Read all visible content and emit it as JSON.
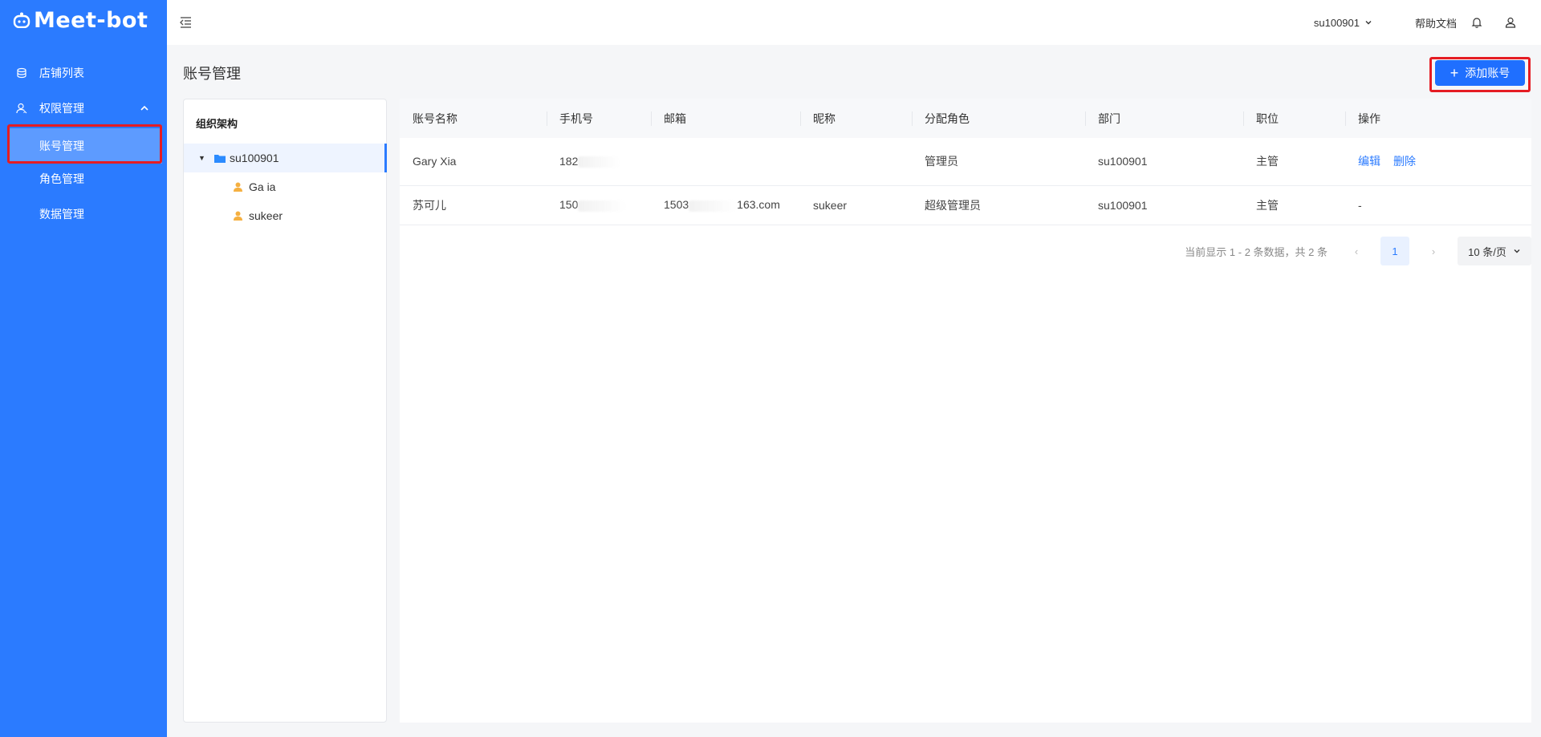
{
  "app": {
    "logo": "Meet-bot"
  },
  "sidebar": {
    "items": [
      {
        "label": "店铺列表",
        "icon": "store-list-icon"
      },
      {
        "label": "权限管理",
        "icon": "user-permission-icon",
        "expanded": true
      },
      {
        "label": "账号管理",
        "active": true
      },
      {
        "label": "角色管理"
      },
      {
        "label": "数据管理"
      }
    ]
  },
  "header": {
    "user": "su100901",
    "help": "帮助文档"
  },
  "page": {
    "title": "账号管理",
    "add_button": "添加账号",
    "add_icon": "+"
  },
  "org": {
    "title": "组织架构",
    "root": "su100901",
    "children": [
      "Ga      ia",
      "sukeer"
    ]
  },
  "table": {
    "columns": [
      "账号名称",
      "手机号",
      "邮箱",
      "昵称",
      "分配角色",
      "部门",
      "职位",
      "操作"
    ],
    "rows": [
      {
        "name": "Gary Xia",
        "phone": "182",
        "email": "",
        "nickname": "",
        "role": "管理员",
        "dept": "su100901",
        "position": "主管",
        "actions": [
          "编辑",
          "删除"
        ]
      },
      {
        "name": "苏可儿",
        "phone": "150",
        "email_prefix": "1503",
        "email_suffix": "163.com",
        "nickname": "sukeer",
        "role": "超级管理员",
        "dept": "su100901",
        "position": "主管",
        "actions_text": "-"
      }
    ]
  },
  "pagination": {
    "info": "当前显示 1 - 2 条数据，共 2 条",
    "current": "1",
    "page_size": "10 条/页"
  },
  "colors": {
    "sidebar": "#2b7bff",
    "primary": "#1f6fff",
    "highlight": "#e51c23"
  }
}
